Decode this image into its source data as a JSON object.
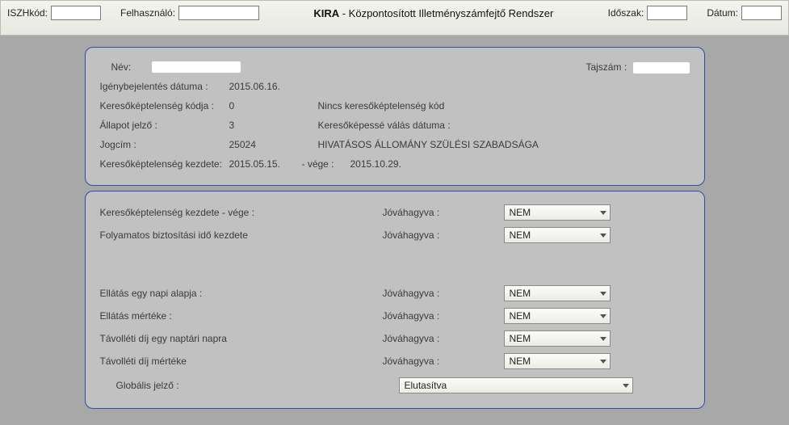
{
  "header": {
    "iszh_label": "ISZHkód:",
    "user_label": "Felhasználó:",
    "title_bold": "KIRA",
    "title_rest": " - Központosított Illetményszámfejtő Rendszer",
    "period_label": "Időszak:",
    "date_label": "Dátum:",
    "iszh_value": "",
    "user_value": "",
    "period_value": "",
    "date_value": ""
  },
  "info": {
    "name_label": "Név:",
    "taj_label": "Tajszám :",
    "claim_date_label": "Igénybejelentés dátuma :",
    "claim_date": "2015.06.16.",
    "incapacity_code_label": "Keresőképtelenség kódja :",
    "incapacity_code": "0",
    "incapacity_code_text": "Nincs keresőképtelenség kód",
    "state_flag_label": "Állapot jelző :",
    "state_flag": "3",
    "capable_date_label": "Keresőképessé válás dátuma :",
    "title_code_label": "Jogcím :",
    "title_code": "25024",
    "title_text": "HIVATÁSOS ÁLLOMÁNY SZÜLÉSI SZABADSÁGA",
    "incapacity_start_label": "Keresőképtelenség kezdete:",
    "incapacity_start": "2015.05.15.",
    "incapacity_end_label": "- vége :",
    "incapacity_end": "2015.10.29."
  },
  "approve": {
    "approved_label": "Jóváhagyva :",
    "r1_label": "Keresőképtelenség kezdete - vége :",
    "r1_value": "NEM",
    "r2_label": "Folyamatos biztosítási idő kezdete",
    "r2_value": "NEM",
    "r3_label": "Ellátás egy napi alapja :",
    "r3_value": "NEM",
    "r4_label": "Ellátás mértéke :",
    "r4_value": "NEM",
    "r5_label": "Távolléti díj egy naptári napra",
    "r5_value": "NEM",
    "r6_label": "Távolléti díj mértéke",
    "r6_value": "NEM",
    "global_label": "Globális jelző :",
    "global_value": "Elutasítva"
  }
}
